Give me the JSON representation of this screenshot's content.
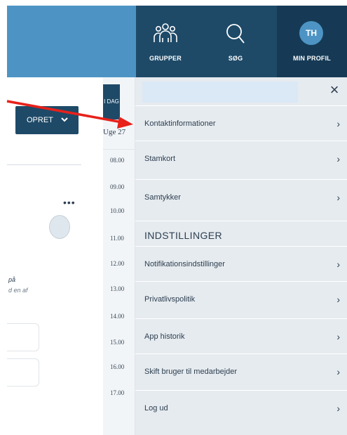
{
  "nav": {
    "groups_label": "GRUPPER",
    "search_label": "SØG",
    "profile_label": "MIN PROFIL",
    "avatar_initials": "TH"
  },
  "left": {
    "create_label": "OPRET",
    "text1": "på",
    "text2": "d en af",
    "dots": "•••"
  },
  "calendar": {
    "today_label": "I DAG",
    "week_label": "Uge 27",
    "hours": [
      "08.00",
      "09.00",
      "10.00",
      "11.00",
      "12.00",
      "13.00",
      "14.00",
      "15.00",
      "16.00",
      "17.00"
    ]
  },
  "menu": {
    "items_top": [
      {
        "label": "Kontaktinformationer"
      },
      {
        "label": "Stamkort"
      },
      {
        "label": "Samtykker"
      }
    ],
    "settings_heading": "INDSTILLINGER",
    "items_settings": [
      {
        "label": "Notifikationsindstillinger"
      },
      {
        "label": "Privatlivspolitik"
      },
      {
        "label": "App historik"
      },
      {
        "label": "Skift bruger til medarbejder"
      },
      {
        "label": "Log ud"
      }
    ],
    "close_glyph": "×",
    "chevron_glyph": "›"
  },
  "colors": {
    "header_light": "#4d94c4",
    "header_dark": "#1e4a68",
    "menu_bg": "#e6ebef",
    "annotation_arrow": "#e8211a"
  }
}
